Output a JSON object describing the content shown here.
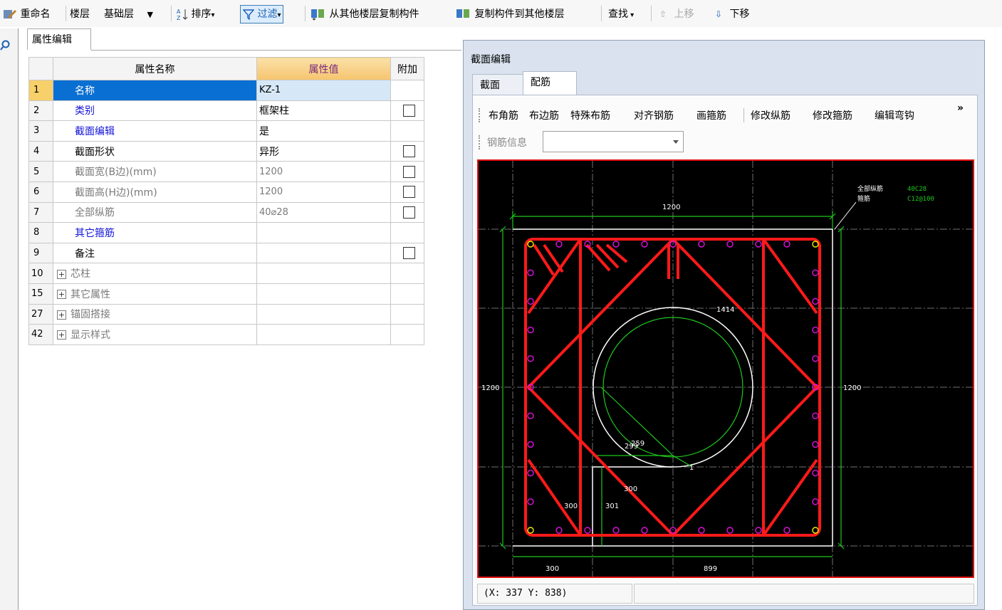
{
  "toolbar": {
    "rename": "重命名",
    "floor_label": "楼层",
    "floor_value": "基础层",
    "sort": "排序",
    "filter": "过滤",
    "copy_from": "从其他楼层复制构件",
    "copy_to": "复制构件到其他楼层",
    "find": "查找",
    "move_up": "上移",
    "move_down": "下移"
  },
  "prop_panel": {
    "tab": "属性编辑",
    "headers": {
      "name": "属性名称",
      "value": "属性值",
      "extra": "附加"
    },
    "rows": [
      {
        "num": "1",
        "name": "名称",
        "value": "KZ-1"
      },
      {
        "num": "2",
        "name": "类别",
        "value": "框架柱"
      },
      {
        "num": "3",
        "name": "截面编辑",
        "value": "是"
      },
      {
        "num": "4",
        "name": "截面形状",
        "value": "异形"
      },
      {
        "num": "5",
        "name": "截面宽(B边)(mm)",
        "value": "1200"
      },
      {
        "num": "6",
        "name": "截面高(H边)(mm)",
        "value": "1200"
      },
      {
        "num": "7",
        "name": "全部纵筋",
        "value": "40⌀28"
      },
      {
        "num": "8",
        "name": "其它箍筋",
        "value": ""
      },
      {
        "num": "9",
        "name": "备注",
        "value": ""
      },
      {
        "num": "10",
        "name": "芯柱",
        "value": ""
      },
      {
        "num": "15",
        "name": "其它属性",
        "value": ""
      },
      {
        "num": "27",
        "name": "锚固搭接",
        "value": ""
      },
      {
        "num": "42",
        "name": "显示样式",
        "value": ""
      }
    ]
  },
  "dialog": {
    "title": "截面编辑",
    "tabs": [
      "截面",
      "配筋"
    ],
    "buttons": [
      "布角筋",
      "布边筋",
      "特殊布筋",
      "对齐钢筋",
      "画箍筋",
      "修改纵筋",
      "修改箍筋",
      "编辑弯钩"
    ],
    "more": "»",
    "rebar_info_label": "钢筋信息",
    "rebar_info_value": "",
    "coord": "(X: 337 Y: 838)"
  },
  "drawing": {
    "dim_top": "1200",
    "dim_left": "1200",
    "dim_right": "1200",
    "dim_circle": "1414",
    "dim_300a": "300",
    "dim_300b": "300",
    "dim_301": "301",
    "dim_bottom_left": "300",
    "dim_bottom_right": "899",
    "dim_small_a": "299",
    "dim_small_b": "259",
    "dim_one": "1",
    "legend_label1": "全部纵筋",
    "legend_label2": "箍筋",
    "legend_value1": "40C28",
    "legend_value2": "C12@100",
    "colors": {
      "red": "#ff1a1a",
      "green": "#1ec81e",
      "white": "#ffffff",
      "magenta": "#e010e0",
      "yellow": "#f0f000"
    }
  }
}
